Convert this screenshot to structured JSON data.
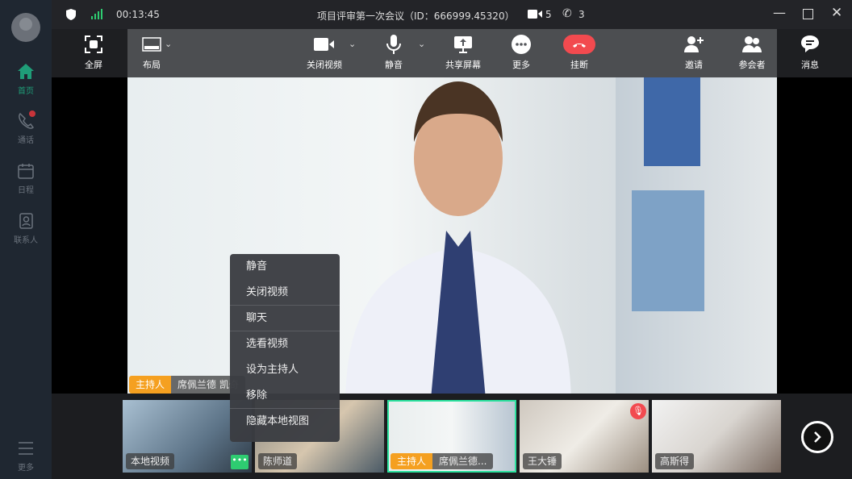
{
  "sidebar": {
    "items": [
      {
        "label": "首页",
        "icon": "home-icon",
        "active": true
      },
      {
        "label": "通话",
        "icon": "phone-icon",
        "badge": true
      },
      {
        "label": "日程",
        "icon": "calendar-icon"
      },
      {
        "label": "联系人",
        "icon": "contacts-icon"
      }
    ],
    "more": "更多"
  },
  "titlebar": {
    "time": "00:13:45",
    "title": "项目评审第一次会议（ID：666999.45320）",
    "video_count": "5",
    "phone_count": "3"
  },
  "toolbar": {
    "fullscreen": "全屏",
    "layout": "布局",
    "video": "关闭视频",
    "mute": "静音",
    "share": "共享屏幕",
    "more": "更多",
    "hangup": "挂断",
    "invite": "邀请",
    "participants": "参会者",
    "messages": "消息"
  },
  "colors": {
    "accent": "#1f9d78",
    "hangup": "#f24a4f",
    "host": "#f5a020",
    "selected": "#2de3a0"
  },
  "main": {
    "host_tag": "主持人",
    "name": "席佩兰德 凯奇"
  },
  "context_menu": [
    "静音",
    "关闭视频",
    "聊天",
    "选看视频",
    "设为主持人",
    "移除",
    "隐藏本地视图"
  ],
  "thumbs": [
    {
      "label": "本地视频"
    },
    {
      "label": "陈师道"
    },
    {
      "host": "主持人",
      "label": "席佩兰德..."
    },
    {
      "label": "王大锤",
      "muted": true
    },
    {
      "label": "高斯得"
    }
  ]
}
